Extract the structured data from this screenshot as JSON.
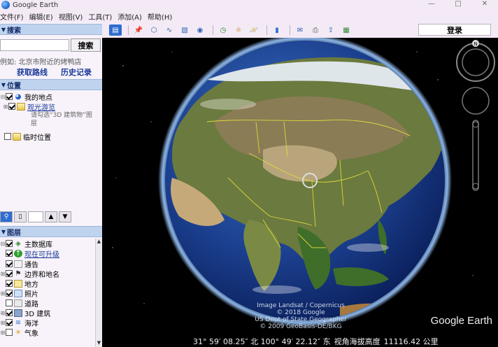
{
  "window": {
    "title": "Google Earth",
    "minimize": "—",
    "restore": "□",
    "close": "✕"
  },
  "menu": [
    "文件(F)",
    "编辑(E)",
    "视图(V)",
    "工具(T)",
    "添加(A)",
    "帮助(H)"
  ],
  "search": {
    "header": "搜索",
    "button": "搜索",
    "example": "例如: 北京市附近的烤鸭店",
    "get_route": "获取路线",
    "history": "历史记录"
  },
  "places": {
    "header": "位置",
    "my_places": "我的地点",
    "sightseeing": "观光游览",
    "sightseeing_note": "请勾选“3D 建筑物”图层",
    "temp": "临时位置"
  },
  "layers": {
    "header": "图层",
    "items": [
      {
        "label": "主数据库",
        "checked": true
      },
      {
        "label": "现在可升级",
        "checked": true
      },
      {
        "label": "通告",
        "checked": true
      },
      {
        "label": "边界和地名",
        "checked": true
      },
      {
        "label": "地方",
        "checked": true
      },
      {
        "label": "照片",
        "checked": true
      },
      {
        "label": "道路",
        "checked": false
      },
      {
        "label": "3D 建筑",
        "checked": true
      },
      {
        "label": "海洋",
        "checked": true
      },
      {
        "label": "气象",
        "checked": false
      }
    ]
  },
  "toolbar": {
    "login": "登录"
  },
  "earth": {
    "compass_north": "N",
    "attribution": [
      "Image Landsat / Copernicus",
      "© 2018 Google",
      "US Dept of State Geographer",
      "© 2009 GeoBasis-DE/BKG"
    ],
    "brand": "Google Earth"
  },
  "status": {
    "coords": "31° 59′ 08.25″ 北 100° 49′ 22.12″ 东",
    "eye_alt_label": "视角海拔高度",
    "eye_alt_value": "11116.42 公里"
  }
}
